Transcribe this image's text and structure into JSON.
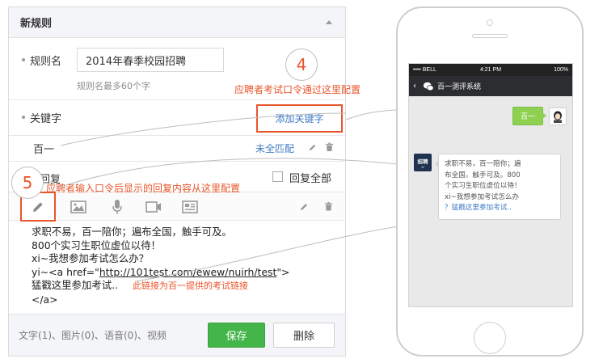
{
  "panel": {
    "title": "新规则",
    "rule_name_label": "规则名",
    "rule_name_value": "2014年春季校园招聘",
    "rule_name_hint": "规则名最多60个字",
    "keyword_label": "关键字",
    "add_keyword_label": "添加关键字",
    "keyword_value": "百一",
    "match_mode_label": "未全匹配",
    "reply_label": "回复",
    "reply_all_label": "回复全部",
    "reply_content_lines": [
      "求职不易，百一陪你；遍布全国，触手可及。",
      "800个实习生职位虚位以待！",
      "xi~我想参加考试怎么办？"
    ],
    "reply_link_prefix": "yi~<a href=\"",
    "reply_link_url": "http://101test.com/ewew/nuirh/test",
    "reply_link_suffix": "\">",
    "reply_link_text": "猛戳这里参加考试..",
    "reply_link_close": "</a>",
    "footer_stats": "文字(1)、图片(0)、语音(0)、视频",
    "save_label": "保存",
    "delete_label": "删除"
  },
  "annotations": {
    "step4_number": "4",
    "step4_text": "应聘者考试口令通过这里配置",
    "step5_number": "5",
    "step5_text": "应聘者输入口令后显示的回复内容从这里配置",
    "link_note": "此链接为百一提供的考试链接"
  },
  "phone": {
    "carrier": "•••• BELL",
    "time": "4:21 PM",
    "battery": "100%",
    "chat_title": "百一测评系统",
    "user_message": "百一",
    "bot_avatar_text": "招聘",
    "bot_reply_lines": [
      "求职不易，百一陪你；遍",
      "布全国，触手可及。800",
      "个实习生职位虚位以待！",
      "xi~我想参加考试怎么办",
      "？猛戳这里参加考试.."
    ]
  },
  "colors": {
    "accent_orange": "#e9552a",
    "link_blue": "#3f7bc4",
    "save_green": "#44b549",
    "chat_bubble_green": "#8ed04f"
  },
  "icons": [
    "chevron-up-icon",
    "trash-icon",
    "pencil-icon",
    "image-icon",
    "microphone-icon",
    "video-icon",
    "news-card-icon",
    "wechat-icon",
    "user-avatar-icon"
  ]
}
